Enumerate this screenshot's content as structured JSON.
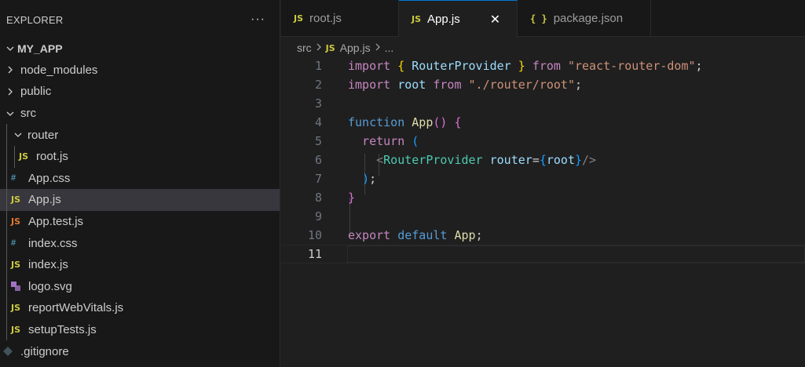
{
  "explorer": {
    "title": "EXPLORER",
    "more": "···",
    "root": "MY_APP",
    "items": [
      {
        "label": "node_modules",
        "kind": "folder",
        "expanded": false,
        "depth": 1
      },
      {
        "label": "public",
        "kind": "folder",
        "expanded": false,
        "depth": 1
      },
      {
        "label": "src",
        "kind": "folder",
        "expanded": true,
        "depth": 1
      },
      {
        "label": "router",
        "kind": "folder",
        "expanded": true,
        "depth": 2
      },
      {
        "label": "root.js",
        "kind": "js",
        "depth": 3
      },
      {
        "label": "App.css",
        "kind": "css",
        "depth": 2
      },
      {
        "label": "App.js",
        "kind": "js",
        "depth": 2,
        "active": true
      },
      {
        "label": "App.test.js",
        "kind": "jstest",
        "depth": 2
      },
      {
        "label": "index.css",
        "kind": "css",
        "depth": 2
      },
      {
        "label": "index.js",
        "kind": "js",
        "depth": 2
      },
      {
        "label": "logo.svg",
        "kind": "svg",
        "depth": 2
      },
      {
        "label": "reportWebVitals.js",
        "kind": "js",
        "depth": 2
      },
      {
        "label": "setupTests.js",
        "kind": "js",
        "depth": 2
      },
      {
        "label": ".gitignore",
        "kind": "git",
        "depth": 1
      }
    ]
  },
  "icons": {
    "js": "JS",
    "css": "#",
    "json": "{ }",
    "chevron_right": "chevron-right-icon",
    "chevron_down": "chevron-down-icon"
  },
  "tabs": [
    {
      "label": "root.js",
      "active": false
    },
    {
      "label": "App.js",
      "active": true,
      "close": "✕"
    },
    {
      "label": "package.json",
      "active": false
    }
  ],
  "breadcrumb": {
    "folder": "src",
    "file": "App.js",
    "more": "..."
  },
  "code": {
    "current_line": 11,
    "lines": [
      "import { RouterProvider } from \"react-router-dom\";",
      "import root from \"./router/root\";",
      "",
      "function App() {",
      "  return (",
      "    <RouterProvider router={root}/>",
      "  );",
      "}",
      "",
      "export default App;",
      ""
    ]
  },
  "colors": {
    "accent": "#0078d4",
    "js_icon": "#cbcb41",
    "css_icon": "#519aba",
    "test_icon": "#e37933",
    "keyword": "#c586c0",
    "string": "#ce9178",
    "variable": "#9cdcfe"
  }
}
